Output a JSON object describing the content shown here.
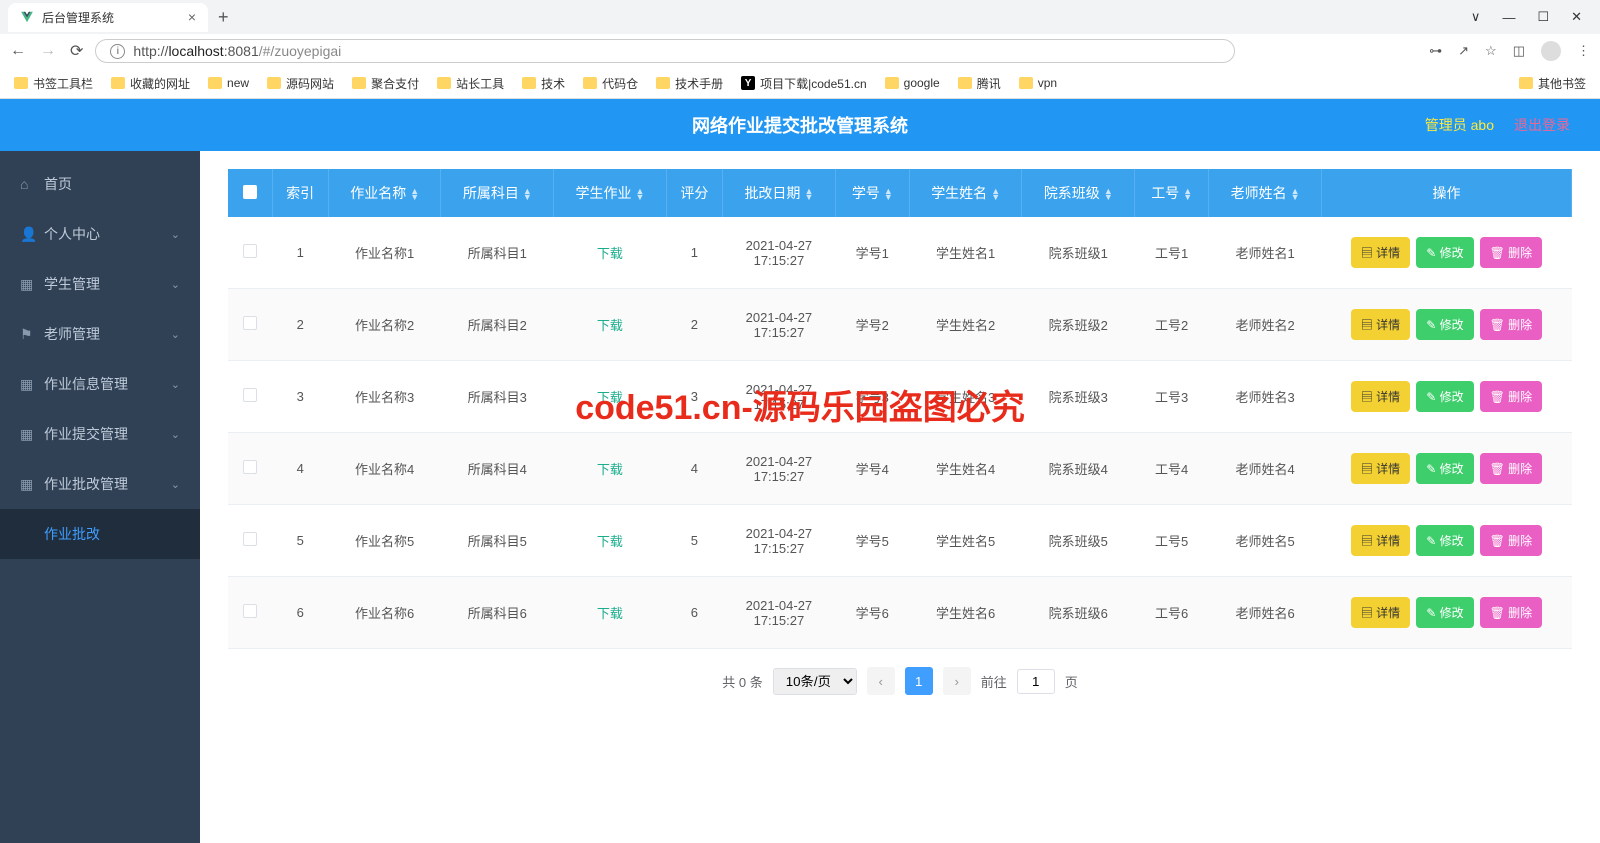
{
  "browser": {
    "tab_title": "后台管理系统",
    "url_host": "localhost",
    "url_port": ":8081",
    "url_path": "/#/zuoyepigai",
    "url_protocol": "http://",
    "bookmarks": [
      "书签工具栏",
      "收藏的网址",
      "new",
      "源码网站",
      "聚合支付",
      "站长工具",
      "技术",
      "代码仓",
      "技术手册",
      "项目下载|code51.cn",
      "google",
      "腾讯",
      "vpn"
    ],
    "bookmark_right": "其他书签"
  },
  "header": {
    "title": "网络作业提交批改管理系统",
    "user": "管理员 abo",
    "logout": "退出登录"
  },
  "sidebar": {
    "items": [
      {
        "label": "首页",
        "icon": "home",
        "has_arrow": false
      },
      {
        "label": "个人中心",
        "icon": "user",
        "has_arrow": true
      },
      {
        "label": "学生管理",
        "icon": "grid",
        "has_arrow": true
      },
      {
        "label": "老师管理",
        "icon": "flag",
        "has_arrow": true
      },
      {
        "label": "作业信息管理",
        "icon": "grid",
        "has_arrow": true
      },
      {
        "label": "作业提交管理",
        "icon": "grid",
        "has_arrow": true
      },
      {
        "label": "作业批改管理",
        "icon": "grid",
        "has_arrow": true,
        "expanded": true
      }
    ],
    "active_sub": "作业批改"
  },
  "table": {
    "headers": [
      "",
      "索引",
      "作业名称",
      "所属科目",
      "学生作业",
      "评分",
      "批改日期",
      "学号",
      "学生姓名",
      "院系班级",
      "工号",
      "老师姓名",
      "操作"
    ],
    "download_label": "下载",
    "rows": [
      {
        "idx": "1",
        "name": "作业名称1",
        "subject": "所属科目1",
        "score": "1",
        "date": "2021-04-27 17:15:27",
        "sid": "学号1",
        "sname": "学生姓名1",
        "class": "院系班级1",
        "tid": "工号1",
        "tname": "老师姓名1"
      },
      {
        "idx": "2",
        "name": "作业名称2",
        "subject": "所属科目2",
        "score": "2",
        "date": "2021-04-27 17:15:27",
        "sid": "学号2",
        "sname": "学生姓名2",
        "class": "院系班级2",
        "tid": "工号2",
        "tname": "老师姓名2"
      },
      {
        "idx": "3",
        "name": "作业名称3",
        "subject": "所属科目3",
        "score": "3",
        "date": "2021-04-27 17:15:27",
        "sid": "学号3",
        "sname": "学生姓名3",
        "class": "院系班级3",
        "tid": "工号3",
        "tname": "老师姓名3"
      },
      {
        "idx": "4",
        "name": "作业名称4",
        "subject": "所属科目4",
        "score": "4",
        "date": "2021-04-27 17:15:27",
        "sid": "学号4",
        "sname": "学生姓名4",
        "class": "院系班级4",
        "tid": "工号4",
        "tname": "老师姓名4"
      },
      {
        "idx": "5",
        "name": "作业名称5",
        "subject": "所属科目5",
        "score": "5",
        "date": "2021-04-27 17:15:27",
        "sid": "学号5",
        "sname": "学生姓名5",
        "class": "院系班级5",
        "tid": "工号5",
        "tname": "老师姓名5"
      },
      {
        "idx": "6",
        "name": "作业名称6",
        "subject": "所属科目6",
        "score": "6",
        "date": "2021-04-27 17:15:27",
        "sid": "学号6",
        "sname": "学生姓名6",
        "class": "院系班级6",
        "tid": "工号6",
        "tname": "老师姓名6"
      }
    ],
    "actions": {
      "detail": "详情",
      "edit": "修改",
      "delete": "删除"
    }
  },
  "pager": {
    "total": "共 0 条",
    "page_size": "10条/页",
    "current": "1",
    "goto_prefix": "前往",
    "goto_value": "1",
    "goto_suffix": "页"
  },
  "watermark": "code51.cn-源码乐园盗图必究"
}
